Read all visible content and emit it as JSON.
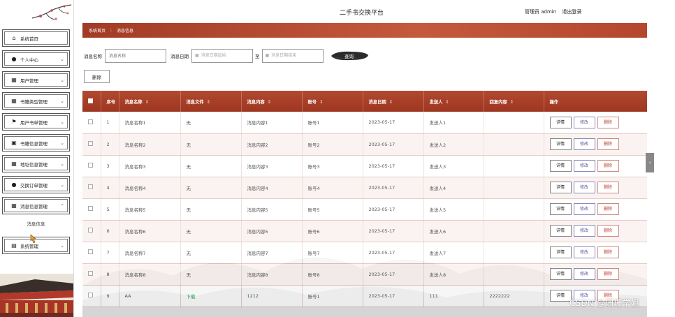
{
  "header": {
    "site_title": "二手书交换平台",
    "user_label": "管理员 admin",
    "logout_label": "退出登录"
  },
  "sidebar": {
    "items": [
      {
        "label": "系统首页",
        "icon": "home-icon",
        "has_chevron": false
      },
      {
        "label": "个人中心",
        "icon": "user-icon",
        "has_chevron": true
      },
      {
        "label": "用户管理",
        "icon": "grid-icon",
        "has_chevron": true
      },
      {
        "label": "书籍类型管理",
        "icon": "grid-icon",
        "has_chevron": true
      },
      {
        "label": "用户书单管理",
        "icon": "flag-icon",
        "has_chevron": true
      },
      {
        "label": "书籍信息管理",
        "icon": "briefcase-icon",
        "has_chevron": true
      },
      {
        "label": "地址信息管理",
        "icon": "grid-icon",
        "has_chevron": true
      },
      {
        "label": "交换订单管理",
        "icon": "user-icon",
        "has_chevron": true
      },
      {
        "label": "消息信息管理",
        "icon": "grid-icon",
        "has_chevron": true,
        "expanded": true
      }
    ],
    "sub_item": "消息信息",
    "last_item": {
      "label": "系统管理",
      "icon": "document-icon"
    }
  },
  "breadcrumb": {
    "home": "系统首页",
    "separator": "⋮",
    "current": "消息信息"
  },
  "search": {
    "name_label": "消息名称",
    "name_placeholder": "消息名称",
    "date_label": "消息日期",
    "date_start_placeholder": "消息日期起始",
    "to_label": "至",
    "date_end_placeholder": "消息日期结束",
    "search_button": "查询"
  },
  "delete_button": "删除",
  "table": {
    "columns": [
      "序号",
      "消息名称",
      "消息文件",
      "消息内容",
      "账号",
      "消息日期",
      "发送人",
      "回复内容",
      "操作"
    ],
    "sort_glyph": "⇕",
    "actions": {
      "detail": "详情",
      "edit": "修改",
      "delete": "删除"
    },
    "rows": [
      {
        "index": "1",
        "name": "消息名称1",
        "file": "无",
        "content": "消息内容1",
        "account": "账号1",
        "date": "2023-05-17",
        "sender": "发送人1",
        "reply": ""
      },
      {
        "index": "2",
        "name": "消息名称2",
        "file": "无",
        "content": "消息内容2",
        "account": "账号2",
        "date": "2023-05-17",
        "sender": "发送人2",
        "reply": ""
      },
      {
        "index": "3",
        "name": "消息名称3",
        "file": "无",
        "content": "消息内容3",
        "account": "账号3",
        "date": "2023-05-17",
        "sender": "发送人3",
        "reply": ""
      },
      {
        "index": "4",
        "name": "消息名称4",
        "file": "无",
        "content": "消息内容4",
        "account": "账号4",
        "date": "2023-05-17",
        "sender": "发送人4",
        "reply": ""
      },
      {
        "index": "5",
        "name": "消息名称5",
        "file": "无",
        "content": "消息内容5",
        "account": "账号5",
        "date": "2023-05-17",
        "sender": "发送人5",
        "reply": ""
      },
      {
        "index": "6",
        "name": "消息名称6",
        "file": "无",
        "content": "消息内容6",
        "account": "账号6",
        "date": "2023-05-17",
        "sender": "发送人6",
        "reply": ""
      },
      {
        "index": "7",
        "name": "消息名称7",
        "file": "无",
        "content": "消息内容7",
        "account": "账号7",
        "date": "2023-05-17",
        "sender": "发送人7",
        "reply": ""
      },
      {
        "index": "8",
        "name": "消息名称8",
        "file": "无",
        "content": "消息内容8",
        "account": "账号8",
        "date": "2023-05-17",
        "sender": "发送人8",
        "reply": ""
      },
      {
        "index": "9",
        "name": "AA",
        "file": "下载",
        "file_is_link": true,
        "content": "1212",
        "account": "账号1",
        "date": "2023-05-17",
        "sender": "111",
        "reply": "2222222"
      }
    ]
  },
  "side_tab_glyph": "‹",
  "watermark": "CSDN @珊珊学姐",
  "colors": {
    "theme_red": "#a93f28",
    "download_green": "#1a9a4a",
    "delete_red": "#c0392b"
  }
}
